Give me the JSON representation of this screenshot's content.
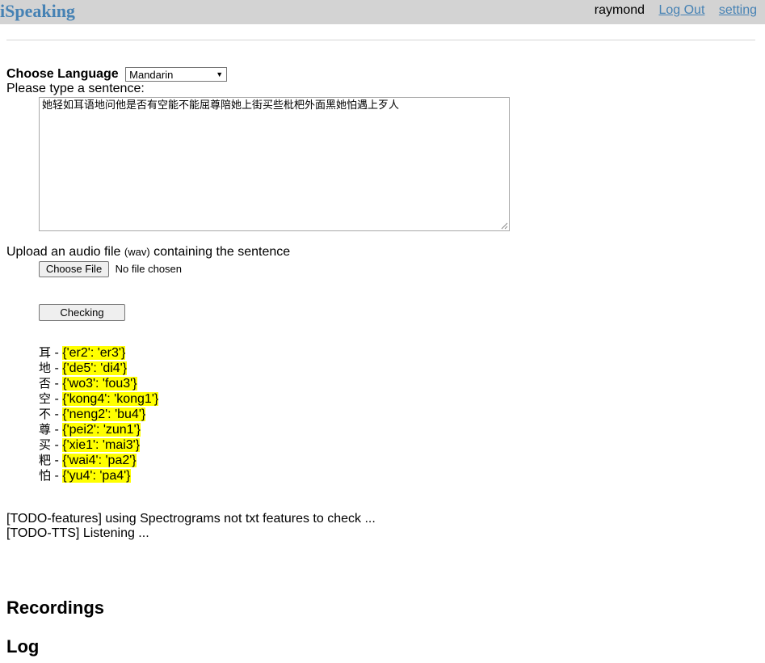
{
  "header": {
    "brand": "iSpeaking",
    "username": "raymond",
    "logout_label": "Log Out",
    "setting_label": "setting"
  },
  "form": {
    "language_label": "Choose Language",
    "language_selected": "Mandarin",
    "prompt": "Please type a sentence:",
    "sentence": "她轻如耳语地问他是否有空能不能屈尊陪她上街买些枇杷外面黑她怕遇上歹人",
    "upload_label_pre": "Upload an audio file",
    "upload_label_small": "(wav)",
    "upload_label_post": "containing the sentence",
    "choose_file_label": "Choose File",
    "no_file_text": "No file chosen",
    "check_button_label": "Checking"
  },
  "results": [
    {
      "char": "耳",
      "sep": " - ",
      "value": "{'er2': 'er3'}"
    },
    {
      "char": "地",
      "sep": " - ",
      "value": "{'de5': 'di4'}"
    },
    {
      "char": "否",
      "sep": " - ",
      "value": "{'wo3': 'fou3'}"
    },
    {
      "char": "空",
      "sep": " - ",
      "value": "{'kong4': 'kong1'}"
    },
    {
      "char": "不",
      "sep": " - ",
      "value": "{'neng2': 'bu4'}"
    },
    {
      "char": "尊",
      "sep": " - ",
      "value": "{'pei2': 'zun1'}"
    },
    {
      "char": "买",
      "sep": " - ",
      "value": "{'xie1': 'mai3'}"
    },
    {
      "char": "粑",
      "sep": " - ",
      "value": "{'wai4': 'pa2'}"
    },
    {
      "char": "怕",
      "sep": " - ",
      "value": "{'yu4': 'pa4'}"
    }
  ],
  "todo": [
    "[TODO-features] using Spectrograms not txt features to check ...",
    "[TODO-TTS] Listening ..."
  ],
  "sections": {
    "recordings": "Recordings",
    "log": "Log"
  },
  "colors": {
    "topbar_bg": "#d3d3d3",
    "brand": "#4682b4",
    "highlight": "#ffff00"
  }
}
